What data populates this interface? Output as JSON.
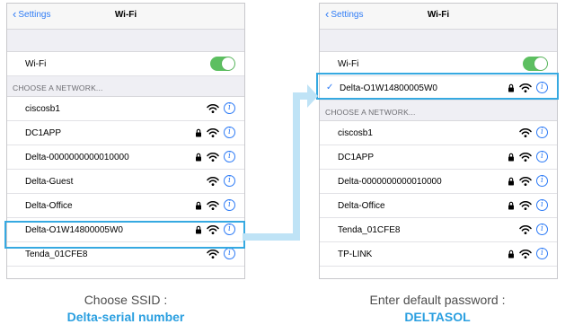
{
  "colors": {
    "accent": "#2f7cf6",
    "highlight": "#36a9e1",
    "toggle_on": "#5cbf60",
    "caption_emphasis": "#2a9fe0"
  },
  "left_screen": {
    "back_label": "Settings",
    "title": "Wi-Fi",
    "wifi_label": "Wi-Fi",
    "wifi_on": true,
    "section_header": "CHOOSE A NETWORK...",
    "networks": [
      {
        "name": "ciscosb1",
        "locked": false
      },
      {
        "name": "DC1APP",
        "locked": true
      },
      {
        "name": "Delta-0000000000010000",
        "locked": true
      },
      {
        "name": "Delta-Guest",
        "locked": false
      },
      {
        "name": "Delta-Office",
        "locked": true
      },
      {
        "name": "Delta-O1W14800005W0",
        "locked": true,
        "highlighted": true
      },
      {
        "name": "Tenda_01CFE8",
        "locked": false
      }
    ]
  },
  "right_screen": {
    "back_label": "Settings",
    "title": "Wi-Fi",
    "wifi_label": "Wi-Fi",
    "wifi_on": true,
    "connected_network": {
      "name": "Delta-O1W14800005W0",
      "locked": true
    },
    "section_header": "CHOOSE A NETWORK...",
    "networks": [
      {
        "name": "ciscosb1",
        "locked": false
      },
      {
        "name": "DC1APP",
        "locked": true
      },
      {
        "name": "Delta-0000000000010000",
        "locked": true
      },
      {
        "name": "Delta-Office",
        "locked": true
      },
      {
        "name": "Tenda_01CFE8",
        "locked": false
      },
      {
        "name": "TP-LINK",
        "locked": true
      }
    ]
  },
  "captions": {
    "left": {
      "line1": "Choose SSID :",
      "line2": "Delta-serial number"
    },
    "right": {
      "line1": "Enter default password :",
      "line2": "DELTASOL"
    }
  },
  "icons": {
    "back": "chevron-left-icon",
    "lock": "lock-icon",
    "wifi": "wifi-icon",
    "info": "info-icon",
    "check": "checkmark-icon"
  }
}
